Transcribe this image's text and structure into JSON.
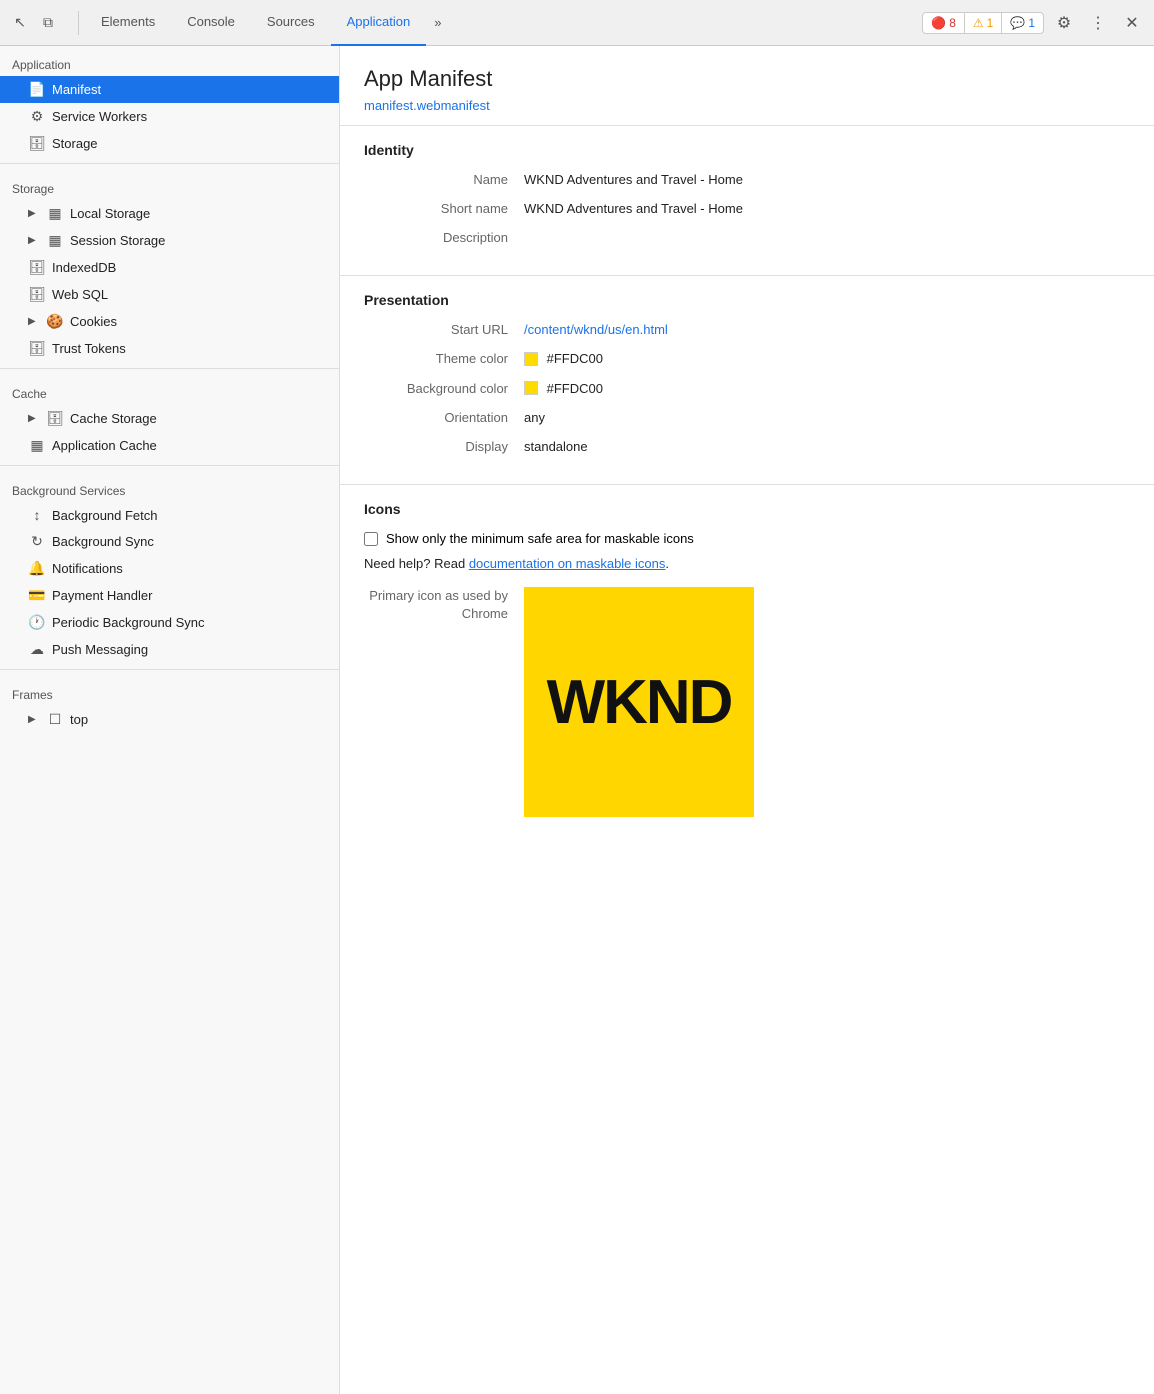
{
  "toolbar": {
    "cursor_icon": "↖",
    "layers_icon": "⧉",
    "tabs": [
      {
        "label": "Elements",
        "active": false
      },
      {
        "label": "Console",
        "active": false
      },
      {
        "label": "Sources",
        "active": false
      },
      {
        "label": "Application",
        "active": true
      }
    ],
    "more_tabs_label": "»",
    "badge_error": "8",
    "badge_warn": "1",
    "badge_info": "1",
    "gear_icon": "⚙",
    "more_icon": "⋮",
    "close_icon": "✕"
  },
  "sidebar": {
    "application_section": "Application",
    "items_application": [
      {
        "label": "Manifest",
        "icon": "📄",
        "active": true
      },
      {
        "label": "Service Workers",
        "icon": "⚙"
      },
      {
        "label": "Storage",
        "icon": "🗄"
      }
    ],
    "storage_section": "Storage",
    "items_storage": [
      {
        "label": "Local Storage",
        "icon": "▦",
        "expandable": true
      },
      {
        "label": "Session Storage",
        "icon": "▦",
        "expandable": true
      },
      {
        "label": "IndexedDB",
        "icon": "🗄"
      },
      {
        "label": "Web SQL",
        "icon": "🗄"
      },
      {
        "label": "Cookies",
        "icon": "🍪",
        "expandable": true
      },
      {
        "label": "Trust Tokens",
        "icon": "🗄"
      }
    ],
    "cache_section": "Cache",
    "items_cache": [
      {
        "label": "Cache Storage",
        "icon": "🗄",
        "expandable": true
      },
      {
        "label": "Application Cache",
        "icon": "▦"
      }
    ],
    "background_section": "Background Services",
    "items_background": [
      {
        "label": "Background Fetch",
        "icon": "↕"
      },
      {
        "label": "Background Sync",
        "icon": "↻"
      },
      {
        "label": "Notifications",
        "icon": "🔔"
      },
      {
        "label": "Payment Handler",
        "icon": "💳"
      },
      {
        "label": "Periodic Background Sync",
        "icon": "🕐"
      },
      {
        "label": "Push Messaging",
        "icon": "☁"
      }
    ],
    "frames_section": "Frames",
    "items_frames": [
      {
        "label": "top",
        "icon": "☐",
        "expandable": true
      }
    ]
  },
  "content": {
    "title": "App Manifest",
    "manifest_link": "manifest.webmanifest",
    "identity_section": "Identity",
    "name_label": "Name",
    "name_value": "WKND Adventures and Travel - Home",
    "short_name_label": "Short name",
    "short_name_value": "WKND Adventures and Travel - Home",
    "description_label": "Description",
    "description_value": "",
    "presentation_section": "Presentation",
    "start_url_label": "Start URL",
    "start_url_value": "/content/wknd/us/en.html",
    "theme_color_label": "Theme color",
    "theme_color_value": "#FFDC00",
    "theme_color_swatch": "#FFDC00",
    "bg_color_label": "Background color",
    "bg_color_value": "#FFDC00",
    "bg_color_swatch": "#FFDC00",
    "orientation_label": "Orientation",
    "orientation_value": "any",
    "display_label": "Display",
    "display_value": "standalone",
    "icons_section": "Icons",
    "checkbox_label": "Show only the minimum safe area for maskable icons",
    "help_text_pre": "Need help? Read ",
    "help_text_link": "documentation on maskable icons",
    "help_text_post": ".",
    "primary_icon_label": "Primary icon as used by",
    "primary_icon_sublabel": "Chrome",
    "icon_text": "WKND",
    "icon_bg_color": "#FFD600"
  }
}
